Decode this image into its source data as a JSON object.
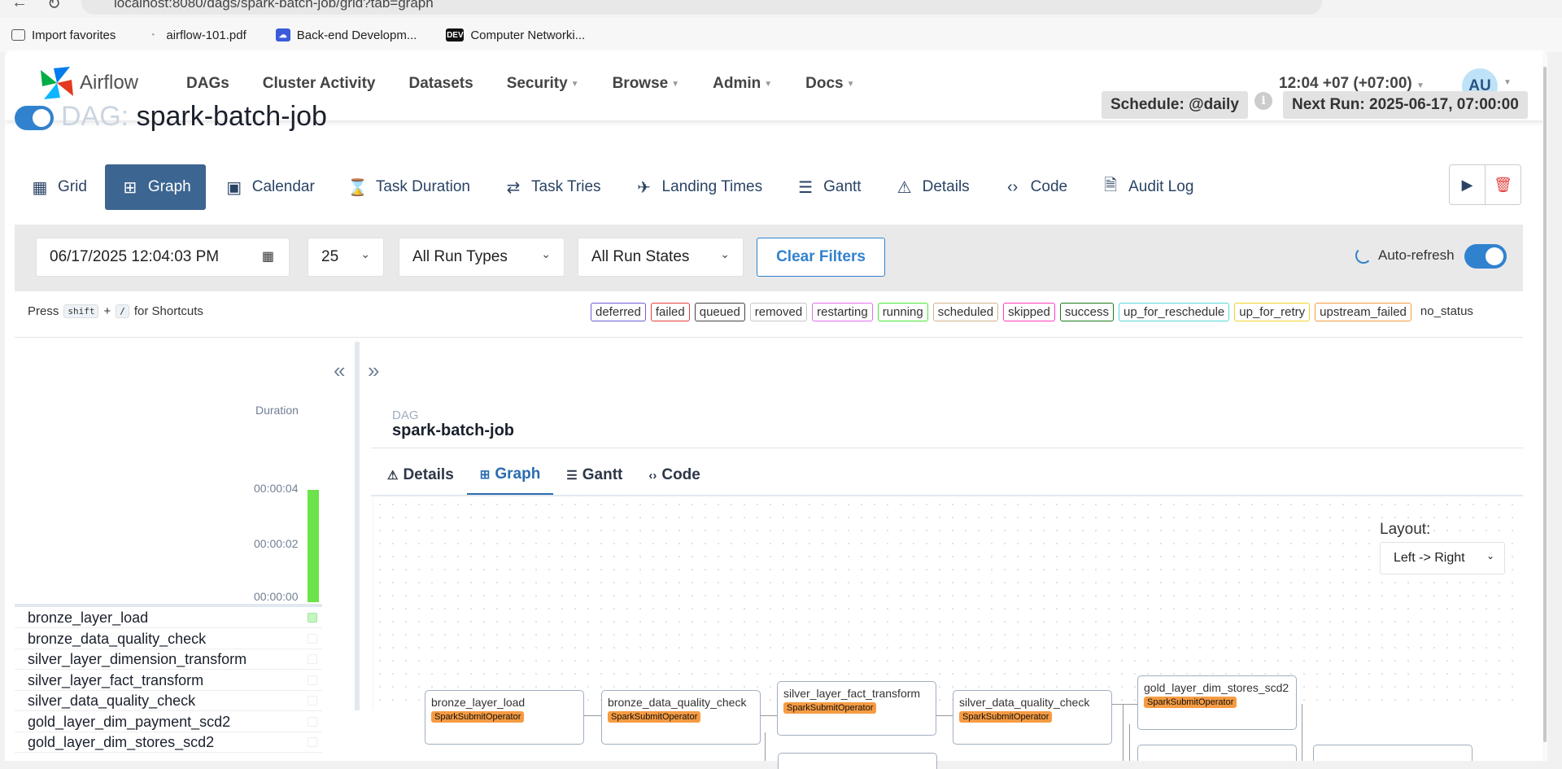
{
  "browser": {
    "url": "localhost:8080/dags/spark-batch-job/grid?tab=graph",
    "bookmarks": [
      {
        "label": "Import favorites",
        "icon": "folder-icon"
      },
      {
        "label": "airflow-101.pdf",
        "icon": "pdf-icon"
      },
      {
        "label": "Back-end Developm...",
        "icon": "cloud-icon"
      },
      {
        "label": "Computer Networki...",
        "icon": "dev-icon",
        "badge": "DEV"
      }
    ]
  },
  "nav": {
    "brand": "Airflow",
    "items": [
      {
        "label": "DAGs",
        "dropdown": false
      },
      {
        "label": "Cluster Activity",
        "dropdown": false
      },
      {
        "label": "Datasets",
        "dropdown": false
      },
      {
        "label": "Security",
        "dropdown": true
      },
      {
        "label": "Browse",
        "dropdown": true
      },
      {
        "label": "Admin",
        "dropdown": true
      },
      {
        "label": "Docs",
        "dropdown": true
      }
    ],
    "clock": "12:04 +07 (+07:00)",
    "avatar": "AU"
  },
  "dag": {
    "prefix": "DAG:",
    "name": "spark-batch-job",
    "schedule": "Schedule: @daily",
    "next_run": "Next Run: 2025-06-17, 07:00:00"
  },
  "tabs": [
    {
      "label": "Grid",
      "icon": "grid-icon",
      "glyph": "▦"
    },
    {
      "label": "Graph",
      "icon": "graph-icon",
      "glyph": "⊞",
      "active": true
    },
    {
      "label": "Calendar",
      "icon": "calendar-icon",
      "glyph": "▣"
    },
    {
      "label": "Task Duration",
      "icon": "hourglass-icon",
      "glyph": "⌛"
    },
    {
      "label": "Task Tries",
      "icon": "retry-icon",
      "glyph": "⇄"
    },
    {
      "label": "Landing Times",
      "icon": "landing-icon",
      "glyph": "✈"
    },
    {
      "label": "Gantt",
      "icon": "gantt-icon",
      "glyph": "☰"
    },
    {
      "label": "Details",
      "icon": "warning-icon",
      "glyph": "⚠"
    },
    {
      "label": "Code",
      "icon": "code-icon",
      "glyph": "‹›"
    },
    {
      "label": "Audit Log",
      "icon": "audit-icon",
      "glyph": "🗎"
    }
  ],
  "filters": {
    "date": "06/17/2025 12:04:03 PM",
    "num_runs": "25",
    "run_types": "All Run Types",
    "run_states": "All Run States",
    "clear": "Clear Filters",
    "autorefresh": "Auto-refresh"
  },
  "shortcuts": {
    "press": "Press",
    "key1": "shift",
    "plus": "+",
    "key2": "/",
    "suffix": "for Shortcuts"
  },
  "legend": [
    {
      "label": "deferred",
      "color": "#6b5fd6"
    },
    {
      "label": "failed",
      "color": "#e53e3e"
    },
    {
      "label": "queued",
      "color": "#444444"
    },
    {
      "label": "removed",
      "color": "#c8c8c8"
    },
    {
      "label": "restarting",
      "color": "#e56ef0"
    },
    {
      "label": "running",
      "color": "#48e83a"
    },
    {
      "label": "scheduled",
      "color": "#d2b48c"
    },
    {
      "label": "skipped",
      "color": "#ff3dbb"
    },
    {
      "label": "success",
      "color": "#1a7a1a"
    },
    {
      "label": "up_for_reschedule",
      "color": "#5ad8d8"
    },
    {
      "label": "up_for_retry",
      "color": "#f2d22a"
    },
    {
      "label": "upstream_failed",
      "color": "#f59b42"
    },
    {
      "label": "no_status",
      "color": "none"
    }
  ],
  "grid": {
    "duration_label": "Duration",
    "ticks": [
      "00:00:04",
      "00:00:02",
      "00:00:00"
    ],
    "bar_fraction": 1.0,
    "tasks": [
      {
        "name": "bronze_layer_load",
        "status": "success"
      },
      {
        "name": "bronze_data_quality_check",
        "status": "none"
      },
      {
        "name": "silver_layer_dimension_transform",
        "status": "none"
      },
      {
        "name": "silver_layer_fact_transform",
        "status": "none"
      },
      {
        "name": "silver_data_quality_check",
        "status": "none"
      },
      {
        "name": "gold_layer_dim_payment_scd2",
        "status": "none"
      },
      {
        "name": "gold_layer_dim_stores_scd2",
        "status": "none"
      }
    ]
  },
  "panel": {
    "crumb_label": "DAG",
    "crumb_name": "spark-batch-job",
    "subtabs": [
      {
        "label": "Details",
        "glyph": "⚠"
      },
      {
        "label": "Graph",
        "glyph": "⊞",
        "active": true
      },
      {
        "label": "Gantt",
        "glyph": "☰"
      },
      {
        "label": "Code",
        "glyph": "‹›"
      }
    ],
    "layout_label": "Layout:",
    "layout_value": "Left -> Right"
  },
  "graph_nodes": [
    {
      "name": "bronze_layer_load",
      "operator": "SparkSubmitOperator"
    },
    {
      "name": "bronze_data_quality_check",
      "operator": "SparkSubmitOperator"
    },
    {
      "name": "silver_layer_fact_transform",
      "operator": "SparkSubmitOperator"
    },
    {
      "name": "silver_data_quality_check",
      "operator": "SparkSubmitOperator"
    },
    {
      "name": "gold_layer_dim_stores_scd2",
      "operator": "SparkSubmitOperator"
    }
  ]
}
